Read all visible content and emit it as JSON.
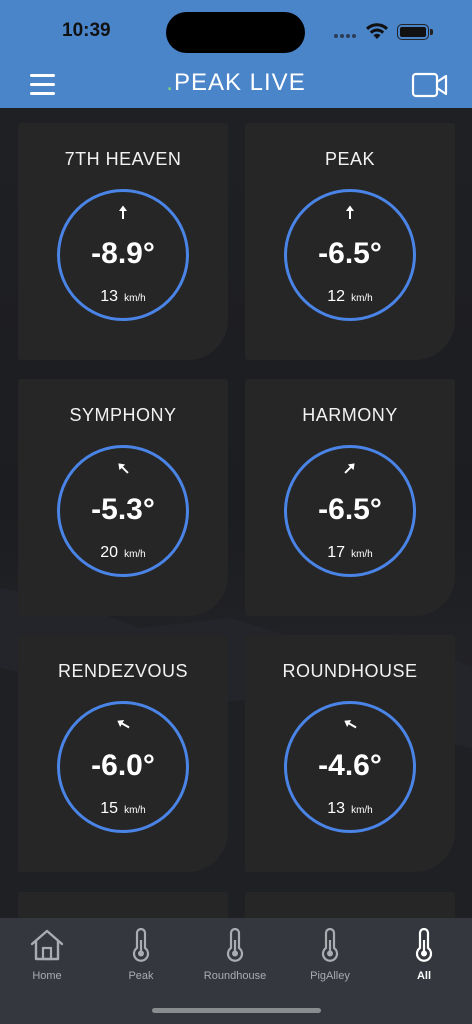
{
  "status": {
    "time": "10:39"
  },
  "nav": {
    "brand_dot": ".",
    "title": "PEAK LIVE"
  },
  "colors": {
    "accent": "#4a84c9",
    "ring": "#4a84e6",
    "brand_dot": "#7ed67a",
    "card": "#262627",
    "tabbar": "#34373d"
  },
  "stations": [
    {
      "name": "7TH HEAVEN",
      "temp": "-8.9°",
      "speed": "13",
      "unit": "km/h",
      "wind_deg": 0
    },
    {
      "name": "PEAK",
      "temp": "-6.5°",
      "speed": "12",
      "unit": "km/h",
      "wind_deg": 0
    },
    {
      "name": "SYMPHONY",
      "temp": "-5.3°",
      "speed": "20",
      "unit": "km/h",
      "wind_deg": -45
    },
    {
      "name": "HARMONY",
      "temp": "-6.5°",
      "speed": "17",
      "unit": "km/h",
      "wind_deg": 45
    },
    {
      "name": "RENDEZVOUS",
      "temp": "-6.0°",
      "speed": "15",
      "unit": "km/h",
      "wind_deg": -60
    },
    {
      "name": "ROUNDHOUSE",
      "temp": "-4.6°",
      "speed": "13",
      "unit": "km/h",
      "wind_deg": -60
    }
  ],
  "tabs": [
    {
      "label": "Home",
      "icon": "home-icon",
      "active": false
    },
    {
      "label": "Peak",
      "icon": "thermometer-icon",
      "active": false
    },
    {
      "label": "Roundhouse",
      "icon": "thermometer-icon",
      "active": false
    },
    {
      "label": "PigAlley",
      "icon": "thermometer-icon",
      "active": false
    },
    {
      "label": "All",
      "icon": "thermometer-icon",
      "active": true
    }
  ]
}
